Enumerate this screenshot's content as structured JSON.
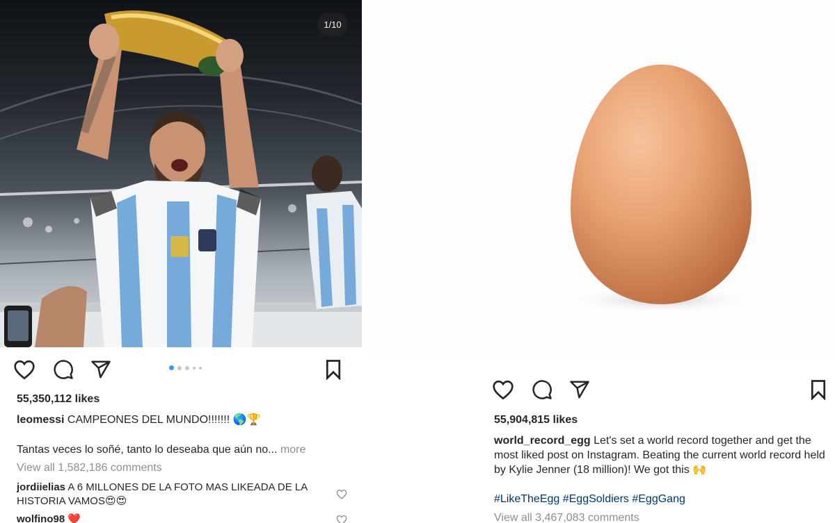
{
  "left_post": {
    "image_counter": "1/10",
    "likes": "55,350,112 likes",
    "caption_user": "leomessi",
    "caption_text": " CAMPEONES DEL MUNDO!!!!!!! 🌎🏆",
    "caption_more_text": "Tantas veces lo soñé, tanto lo deseaba que aún no...",
    "more_label": " more",
    "view_comments": "View all 1,582,186 comments",
    "comments": [
      {
        "user": "jordiielias",
        "text": " A 6 MILLONES DE LA FOTO MAS LIKEADA DE LA HISTORIA VAMOS😍😍"
      },
      {
        "user": "wolfino98",
        "text": " ❤️"
      }
    ],
    "carousel_dots": 5
  },
  "right_post": {
    "likes": "55,904,815 likes",
    "caption_user": "world_record_egg",
    "caption_text": " Let's set a world record together and get the most liked post on Instagram. Beating the current world record held by Kylie Jenner (18 million)! We got this 🙌",
    "hashtags": "#LikeTheEgg #EggSoldiers #EggGang",
    "view_comments": "View all 3,467,083 comments"
  },
  "icons": {
    "like": "heart-icon",
    "comment": "comment-bubble-icon",
    "share": "paper-plane-icon",
    "save": "bookmark-icon"
  },
  "colors": {
    "accent_blue": "#3897f0",
    "hashtag": "#00376b",
    "muted": "#8e8e8e",
    "jersey_blue": "#75aadb",
    "trophy_gold": "#c99a2e",
    "egg": "#e49a6b"
  }
}
